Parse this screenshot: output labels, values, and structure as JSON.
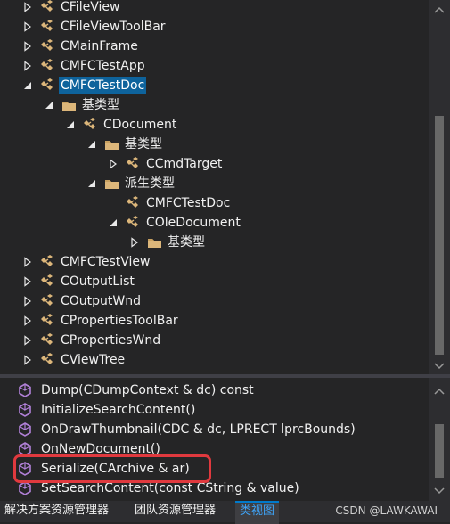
{
  "class_tree": {
    "rows": [
      {
        "label": "CFileView",
        "arrow": "collapsed",
        "icon": "class-icon"
      },
      {
        "label": "CFileViewToolBar",
        "arrow": "collapsed",
        "icon": "class-icon"
      },
      {
        "label": "CMainFrame",
        "arrow": "collapsed",
        "icon": "class-icon"
      },
      {
        "label": "CMFCTestApp",
        "arrow": "collapsed",
        "icon": "class-icon"
      },
      {
        "label": "CMFCTestDoc",
        "arrow": "expanded",
        "icon": "class-icon",
        "selected": true
      },
      {
        "label": "基类型",
        "arrow": "expanded",
        "icon": "folder-icon"
      },
      {
        "label": "CDocument",
        "arrow": "expanded",
        "icon": "class-icon"
      },
      {
        "label": "基类型",
        "arrow": "expanded",
        "icon": "folder-icon"
      },
      {
        "label": "CCmdTarget",
        "arrow": "collapsed",
        "icon": "class-icon"
      },
      {
        "label": "派生类型",
        "arrow": "expanded",
        "icon": "folder-icon"
      },
      {
        "label": "CMFCTestDoc",
        "arrow": "none",
        "icon": "class-icon"
      },
      {
        "label": "COleDocument",
        "arrow": "expanded",
        "icon": "class-icon"
      },
      {
        "label": "基类型",
        "arrow": "collapsed",
        "icon": "folder-icon"
      },
      {
        "label": "CMFCTestView",
        "arrow": "collapsed",
        "icon": "class-icon"
      },
      {
        "label": "COutputList",
        "arrow": "collapsed",
        "icon": "class-icon"
      },
      {
        "label": "COutputWnd",
        "arrow": "collapsed",
        "icon": "class-icon"
      },
      {
        "label": "CPropertiesToolBar",
        "arrow": "collapsed",
        "icon": "class-icon"
      },
      {
        "label": "CPropertiesWnd",
        "arrow": "collapsed",
        "icon": "class-icon"
      },
      {
        "label": "CViewTree",
        "arrow": "collapsed",
        "icon": "class-icon"
      }
    ]
  },
  "members": {
    "rows": [
      {
        "label": "Dump(CDumpContext & dc) const",
        "icon": "method-icon"
      },
      {
        "label": "InitializeSearchContent()",
        "icon": "method-icon"
      },
      {
        "label": "OnDrawThumbnail(CDC & dc, LPRECT lprcBounds)",
        "icon": "method-icon"
      },
      {
        "label": "OnNewDocument()",
        "icon": "method-icon"
      },
      {
        "label": "Serialize(CArchive & ar)",
        "icon": "method-icon",
        "highlighted": true
      },
      {
        "label": "SetSearchContent(const CString & value)",
        "icon": "method-icon"
      }
    ]
  },
  "tabs": [
    {
      "label": "解决方案资源管理器",
      "active": false
    },
    {
      "label": "团队资源管理器",
      "active": false
    },
    {
      "label": "类视图",
      "active": true
    }
  ],
  "watermark": "CSDN @LAWKAWAI",
  "colors": {
    "background": "#252526",
    "selection": "#0e639c",
    "class_icon": "#dcb67a",
    "method_icon": "#b180d7",
    "highlight_border": "#e0393e",
    "active_tab_text": "#3ea2f5"
  }
}
